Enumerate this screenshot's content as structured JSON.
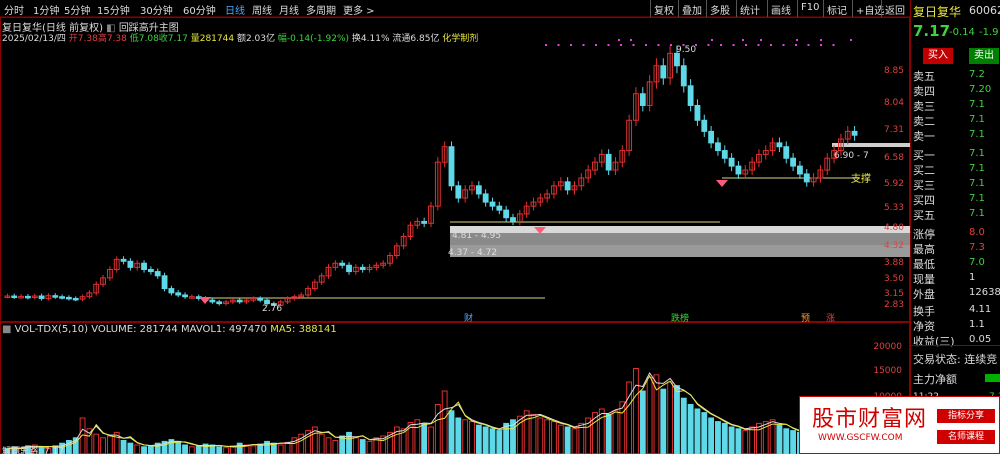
{
  "topbar": {
    "periods": [
      "分时",
      "1分钟",
      "5分钟",
      "15分钟",
      "30分钟",
      "60分钟",
      "日线",
      "周线",
      "月线",
      "多周期",
      "更多 >"
    ],
    "active_period": "日线",
    "buttons": [
      "复权",
      "叠加",
      "多股",
      "统计",
      "画线",
      "F10",
      "标记",
      "+自选",
      "返回"
    ]
  },
  "chart_header": {
    "title": "复日复华(日线 前复权)",
    "indicator": "回踩高升主图",
    "date": "2025/02/13/四",
    "open": "开7.38",
    "high": "高7.38",
    "low": "低7.08",
    "close": "收7.17",
    "volume": "量281744",
    "amount": "额2.03亿",
    "change": "幅-0.14(-1.92%)",
    "turnover": "换4.11%",
    "float": "流通6.85亿",
    "concept": "化学制剂"
  },
  "price_axis": [
    "8.85",
    "8.04",
    "7.31",
    "6.58",
    "5.92",
    "5.33",
    "4.80",
    "4.32",
    "3.88",
    "3.50",
    "3.15",
    "2.83"
  ],
  "annotations": {
    "peak": "9.50",
    "low_point": "2.76",
    "zone1": "4.81 - 4.95",
    "zone2": "4.37 - 4.72",
    "zone3": "6.90 - 7",
    "support": "支撑"
  },
  "event_tags": [
    "财",
    "跌榜",
    "预",
    "涨"
  ],
  "volume_header": {
    "name": "VOL-TDX(5,10)",
    "volume": "VOLUME: 281744",
    "mavol1": "MAVOL1: 497470",
    "ma5": "MA5: 388141"
  },
  "volume_axis": [
    "20000",
    "15000",
    "10000"
  ],
  "bottom_info": "解题思路: 7.17",
  "sidebar": {
    "name": "复日复华",
    "code": "60062",
    "price": "7.17",
    "change": "-0.14",
    "change_pct": "-1.9",
    "buy_button": "买入",
    "sell_button": "卖出",
    "asks": [
      {
        "label": "卖五",
        "price": "7.2"
      },
      {
        "label": "卖四",
        "price": "7.20"
      },
      {
        "label": "卖三",
        "price": "7.1"
      },
      {
        "label": "卖二",
        "price": "7.1"
      },
      {
        "label": "卖一",
        "price": "7.1"
      }
    ],
    "bids": [
      {
        "label": "买一",
        "price": "7.1"
      },
      {
        "label": "买二",
        "price": "7.1"
      },
      {
        "label": "买三",
        "price": "7.1"
      },
      {
        "label": "买四",
        "price": "7.1"
      },
      {
        "label": "买五",
        "price": "7.1"
      }
    ],
    "stats": [
      {
        "label": "涨停",
        "value": "8.0"
      },
      {
        "label": "最高",
        "value": "7.3"
      },
      {
        "label": "最低",
        "value": "7.0"
      },
      {
        "label": "现量",
        "value": "1"
      },
      {
        "label": "外盘",
        "value": "12638"
      }
    ],
    "stats2": [
      {
        "label": "换手",
        "value": "4.11"
      },
      {
        "label": "净资",
        "value": "1.1"
      },
      {
        "label": "收益(三)",
        "value": "0.05"
      }
    ],
    "trade_status": "交易状态: 连续竞",
    "main_flow": "主力净额",
    "time": "11:22",
    "time_val": "7.1"
  },
  "watermark": {
    "title": "股市财富网",
    "url": "WWW.GSCFW.COM",
    "tag1": "指标分享",
    "tag2": "名师课程"
  }
}
